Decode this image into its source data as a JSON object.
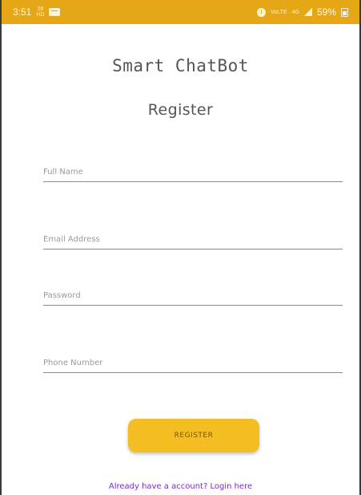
{
  "status_bar": {
    "time": "3:51",
    "left_indicator_top": "28",
    "left_indicator_bottom": "HD",
    "right_indicator_one": "VoLTE",
    "right_indicator_two": "4G",
    "battery_percent": "59%",
    "background": "#e6a717"
  },
  "header": {
    "app_title": "Smart ChatBot",
    "page_title": "Register"
  },
  "form": {
    "full_name": {
      "placeholder": "Full Name",
      "value": ""
    },
    "email": {
      "placeholder": "Email Address",
      "value": ""
    },
    "password": {
      "placeholder": "Password",
      "value": ""
    },
    "phone": {
      "placeholder": "Phone Number",
      "value": ""
    }
  },
  "actions": {
    "register_label": "REGISTER",
    "login_link": "Already have a account? Login here"
  },
  "colors": {
    "accent": "#f4bd21",
    "link": "#7b2cc8"
  },
  "icons": {
    "message": "message-icon",
    "alarm": "alarm-icon",
    "signal": "signal-icon",
    "battery": "battery-icon"
  }
}
